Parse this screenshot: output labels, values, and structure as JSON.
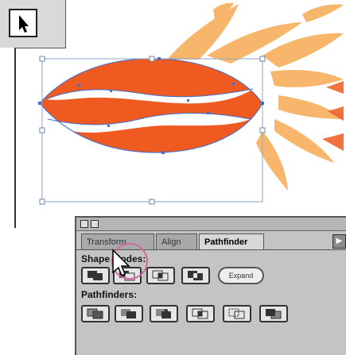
{
  "tools": {
    "selection_tool": {
      "icon": "arrow-pointer-icon",
      "name": "Selection Tool"
    }
  },
  "colors": {
    "artwork_fill": "#ee5a20",
    "artwork_back": "#f7b66b",
    "selection_path": "#3f6fd0",
    "panel_bg": "#c4c4c4",
    "hover_ring": "#d16aa0"
  },
  "panel": {
    "tabs": [
      {
        "label": "Transform",
        "active": false
      },
      {
        "label": "Align",
        "active": false
      },
      {
        "label": "Pathfinder",
        "active": true
      }
    ],
    "shape_modes_label": "Shape Modes:",
    "pathfinders_label": "Pathfinders:",
    "expand_label": "Expand",
    "shape_mode_buttons": [
      {
        "icon": "add-to-shape-area-icon"
      },
      {
        "icon": "subtract-from-shape-area-icon"
      },
      {
        "icon": "intersect-shape-areas-icon"
      },
      {
        "icon": "exclude-overlapping-shape-areas-icon"
      }
    ],
    "pathfinder_buttons": [
      {
        "icon": "divide-icon"
      },
      {
        "icon": "trim-icon"
      },
      {
        "icon": "merge-icon"
      },
      {
        "icon": "crop-icon"
      },
      {
        "icon": "outline-icon"
      },
      {
        "icon": "minus-back-icon"
      }
    ]
  }
}
